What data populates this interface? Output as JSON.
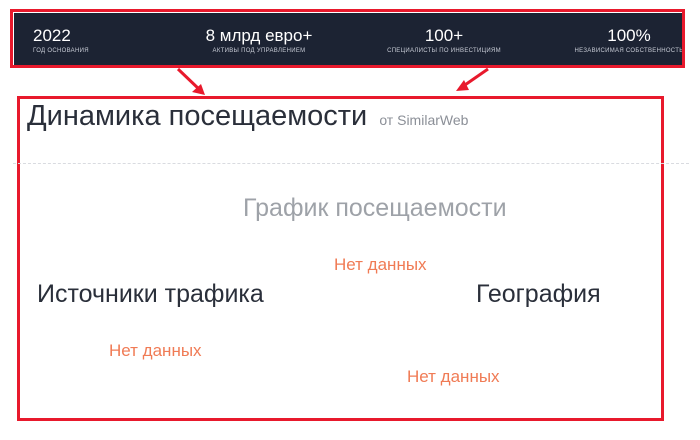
{
  "stats": [
    {
      "value": "2022",
      "label": "ГОД ОСНОВАНИЯ"
    },
    {
      "value": "8 млрд евро+",
      "label": "АКТИВЫ ПОД УПРАВЛЕНИЕМ"
    },
    {
      "value": "100+",
      "label": "СПЕЦИАЛИСТЫ ПО ИНВЕСТИЦИЯМ"
    },
    {
      "value": "100%",
      "label": "НЕЗАВИСИМАЯ СОБСТВЕННОСТЬ"
    }
  ],
  "panel": {
    "title": "Динамика посещаемости",
    "source": "от SimilarWeb",
    "chart_title": "График посещаемости",
    "chart_nodata": "Нет данных",
    "traffic_title": "Источники трафика",
    "traffic_nodata": "Нет данных",
    "geo_title": "География",
    "geo_nodata": "Нет данных"
  },
  "colors": {
    "annotation": "#e8192c",
    "stats_background": "#1c2333",
    "nodata": "#f07b55"
  }
}
